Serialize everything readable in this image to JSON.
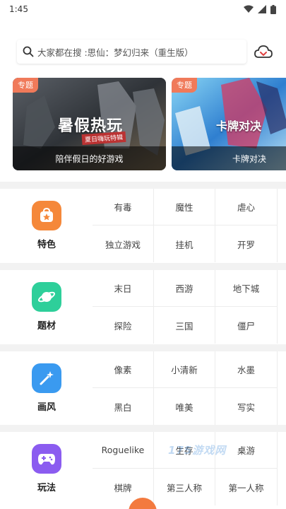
{
  "status_bar": {
    "time": "1:45",
    "icons": [
      "wifi-icon",
      "cell-signal-icon",
      "battery-icon"
    ]
  },
  "search": {
    "placeholder": "大家都在搜 :思仙：梦幻归来（重生版）",
    "icon": "search-icon",
    "cloud_icon": "cloud-download-icon"
  },
  "banners": [
    {
      "tag": "专题",
      "headline": "暑假热玩",
      "subline": "夏日嗨玩特辑",
      "caption": "陪伴假日的好游戏"
    },
    {
      "tag": "专题",
      "headline": "卡牌对决",
      "caption": "卡牌对决"
    }
  ],
  "categories": [
    {
      "title": "特色",
      "icon": "star-bag-icon",
      "color": "#f5883a",
      "tags": [
        "有毒",
        "魔性",
        "虐心",
        "独立游戏",
        "挂机",
        "开罗"
      ]
    },
    {
      "title": "题材",
      "icon": "planet-icon",
      "color": "#2ecf9a",
      "tags": [
        "末日",
        "西游",
        "地下城",
        "探险",
        "三国",
        "僵尸"
      ]
    },
    {
      "title": "画风",
      "icon": "magic-wand-icon",
      "color": "#3a9af0",
      "tags": [
        "像素",
        "小清新",
        "水墨",
        "黑白",
        "唯美",
        "写实"
      ]
    },
    {
      "title": "玩法",
      "icon": "gamepad-icon",
      "color": "#8b5cf0",
      "tags": [
        "Roguelike",
        "生存",
        "桌游",
        "棋牌",
        "第三人称",
        "第一人称"
      ]
    }
  ],
  "watermark": "175游戏网"
}
